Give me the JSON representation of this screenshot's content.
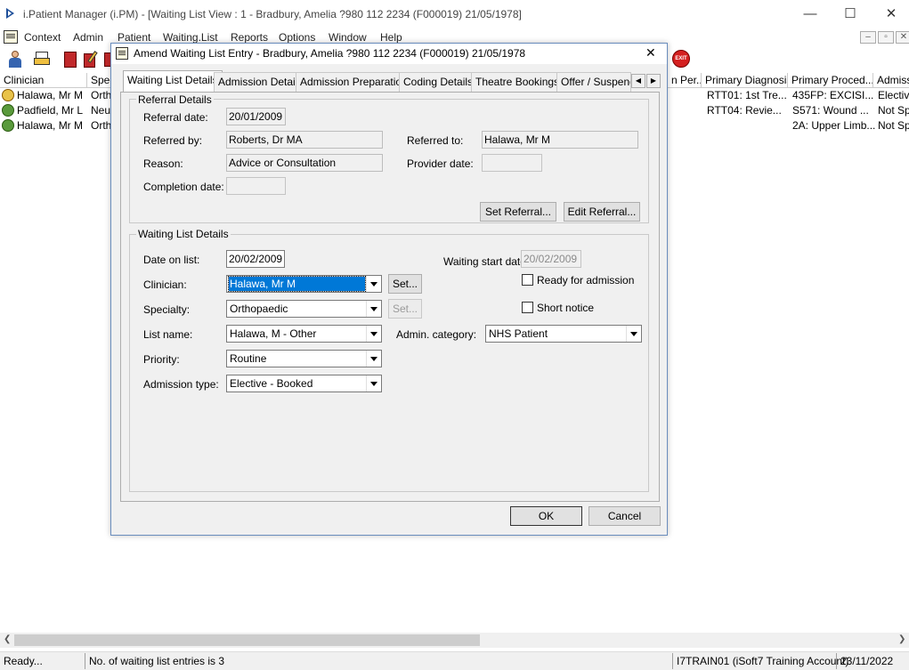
{
  "window": {
    "title": "i.Patient Manager (i.PM) - [Waiting List View :  1 - Bradbury, Amelia ?980 112 2234 (F000019) 21/05/1978]",
    "min": "—",
    "max": "☐",
    "close": "✕"
  },
  "menu": [
    "Context",
    "Admin",
    "Patient",
    "Waiting.List",
    "Reports",
    "Options",
    "Window",
    "Help"
  ],
  "list": {
    "headers": [
      "Clinician",
      "Spec",
      "n Per...",
      "Primary Diagnosis",
      "Primary Proced...",
      "Admissi"
    ],
    "rows": [
      {
        "clinician": "Halawa, Mr M",
        "spec": "Ortho",
        "diag": "RTT01: 1st Tre...",
        "proc": "435FP: EXCISI...",
        "adm": "Elective"
      },
      {
        "clinician": "Padfield, Mr L",
        "spec": "Neur",
        "diag": "RTT04: Revie...",
        "proc": "S571: Wound ...",
        "adm": "Not Spe"
      },
      {
        "clinician": "Halawa, Mr M",
        "spec": "Ortho",
        "diag": "",
        "proc": "2A: Upper Limb...",
        "adm": "Not Spe"
      }
    ]
  },
  "dialog": {
    "title": "Amend Waiting List Entry - Bradbury, Amelia ?980 112 2234 (F000019) 21/05/1978",
    "close": "✕",
    "tabs": [
      "Waiting List Details",
      "Admission Details",
      "Admission Preparation",
      "Coding Details",
      "Theatre Bookings",
      "Offer / Suspend"
    ],
    "tab_prev": "◀",
    "tab_next": "▶",
    "referral": {
      "group_label": "Referral Details",
      "referral_date_label": "Referral date:",
      "referral_date": "20/01/2009",
      "referred_by_label": "Referred by:",
      "referred_by": "Roberts, Dr MA",
      "referred_to_label": "Referred to:",
      "referred_to": "Halawa, Mr M",
      "reason_label": "Reason:",
      "reason": "Advice or Consultation",
      "provider_date_label": "Provider date:",
      "provider_date": "",
      "completion_date_label": "Completion date:",
      "completion_date": "",
      "set_referral": "Set Referral...",
      "edit_referral": "Edit Referral..."
    },
    "wl": {
      "group_label": "Waiting List Details",
      "date_on_list_label": "Date on list:",
      "date_on_list": "20/02/2009",
      "waiting_start_label": "Waiting start date:",
      "waiting_start": "20/02/2009",
      "clinician_label": "Clinician:",
      "clinician": "Halawa, Mr M",
      "set": "Set...",
      "ready_label": "Ready for admission",
      "specialty_label": "Specialty:",
      "specialty": "Orthopaedic",
      "short_notice_label": "Short notice",
      "list_name_label": "List name:",
      "list_name": "Halawa, M - Other",
      "admin_cat_label": "Admin. category:",
      "admin_cat": "NHS Patient",
      "priority_label": "Priority:",
      "priority": "Routine",
      "adm_type_label": "Admission type:",
      "adm_type": "Elective - Booked"
    },
    "ok": "OK",
    "cancel": "Cancel"
  },
  "status": {
    "ready": "Ready...",
    "entries": "No. of waiting list entries is 3",
    "account": "I7TRAIN01 (iSoft7 Training Account)",
    "date": "23/11/2022"
  },
  "colors": {
    "accent": "#0078d7",
    "dialog_border": "#6a8dbd"
  }
}
